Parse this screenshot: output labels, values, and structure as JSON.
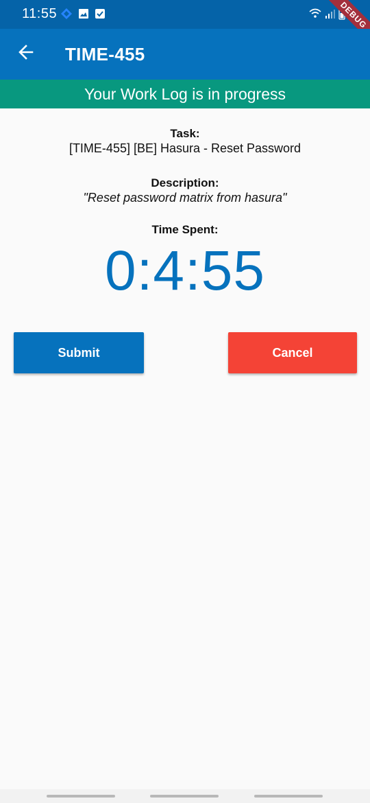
{
  "status_bar": {
    "time": "11:55",
    "left_icons": [
      "jira-icon",
      "image-icon",
      "checkbox-icon"
    ],
    "right_icons": [
      "wifi-icon",
      "signal-icon",
      "battery-icon"
    ],
    "debug_label": "DEBUG"
  },
  "app_bar": {
    "title": "TIME-455"
  },
  "banner": {
    "text": "Your Work Log is in progress"
  },
  "task": {
    "label": "Task:",
    "value": "[TIME-455] [BE] Hasura - Reset Password"
  },
  "description": {
    "label": "Description:",
    "value": "\"Reset password matrix from hasura\""
  },
  "time_spent": {
    "label": "Time Spent:",
    "value": "0:4:55"
  },
  "actions": {
    "submit_label": "Submit",
    "cancel_label": "Cancel"
  },
  "colors": {
    "status_bar": "#0563a8",
    "app_bar": "#0672bd",
    "banner": "#08987f",
    "timer": "#0672bd",
    "submit": "#0672bd",
    "cancel": "#f44336",
    "debug_ribbon": "#a32f3c"
  }
}
